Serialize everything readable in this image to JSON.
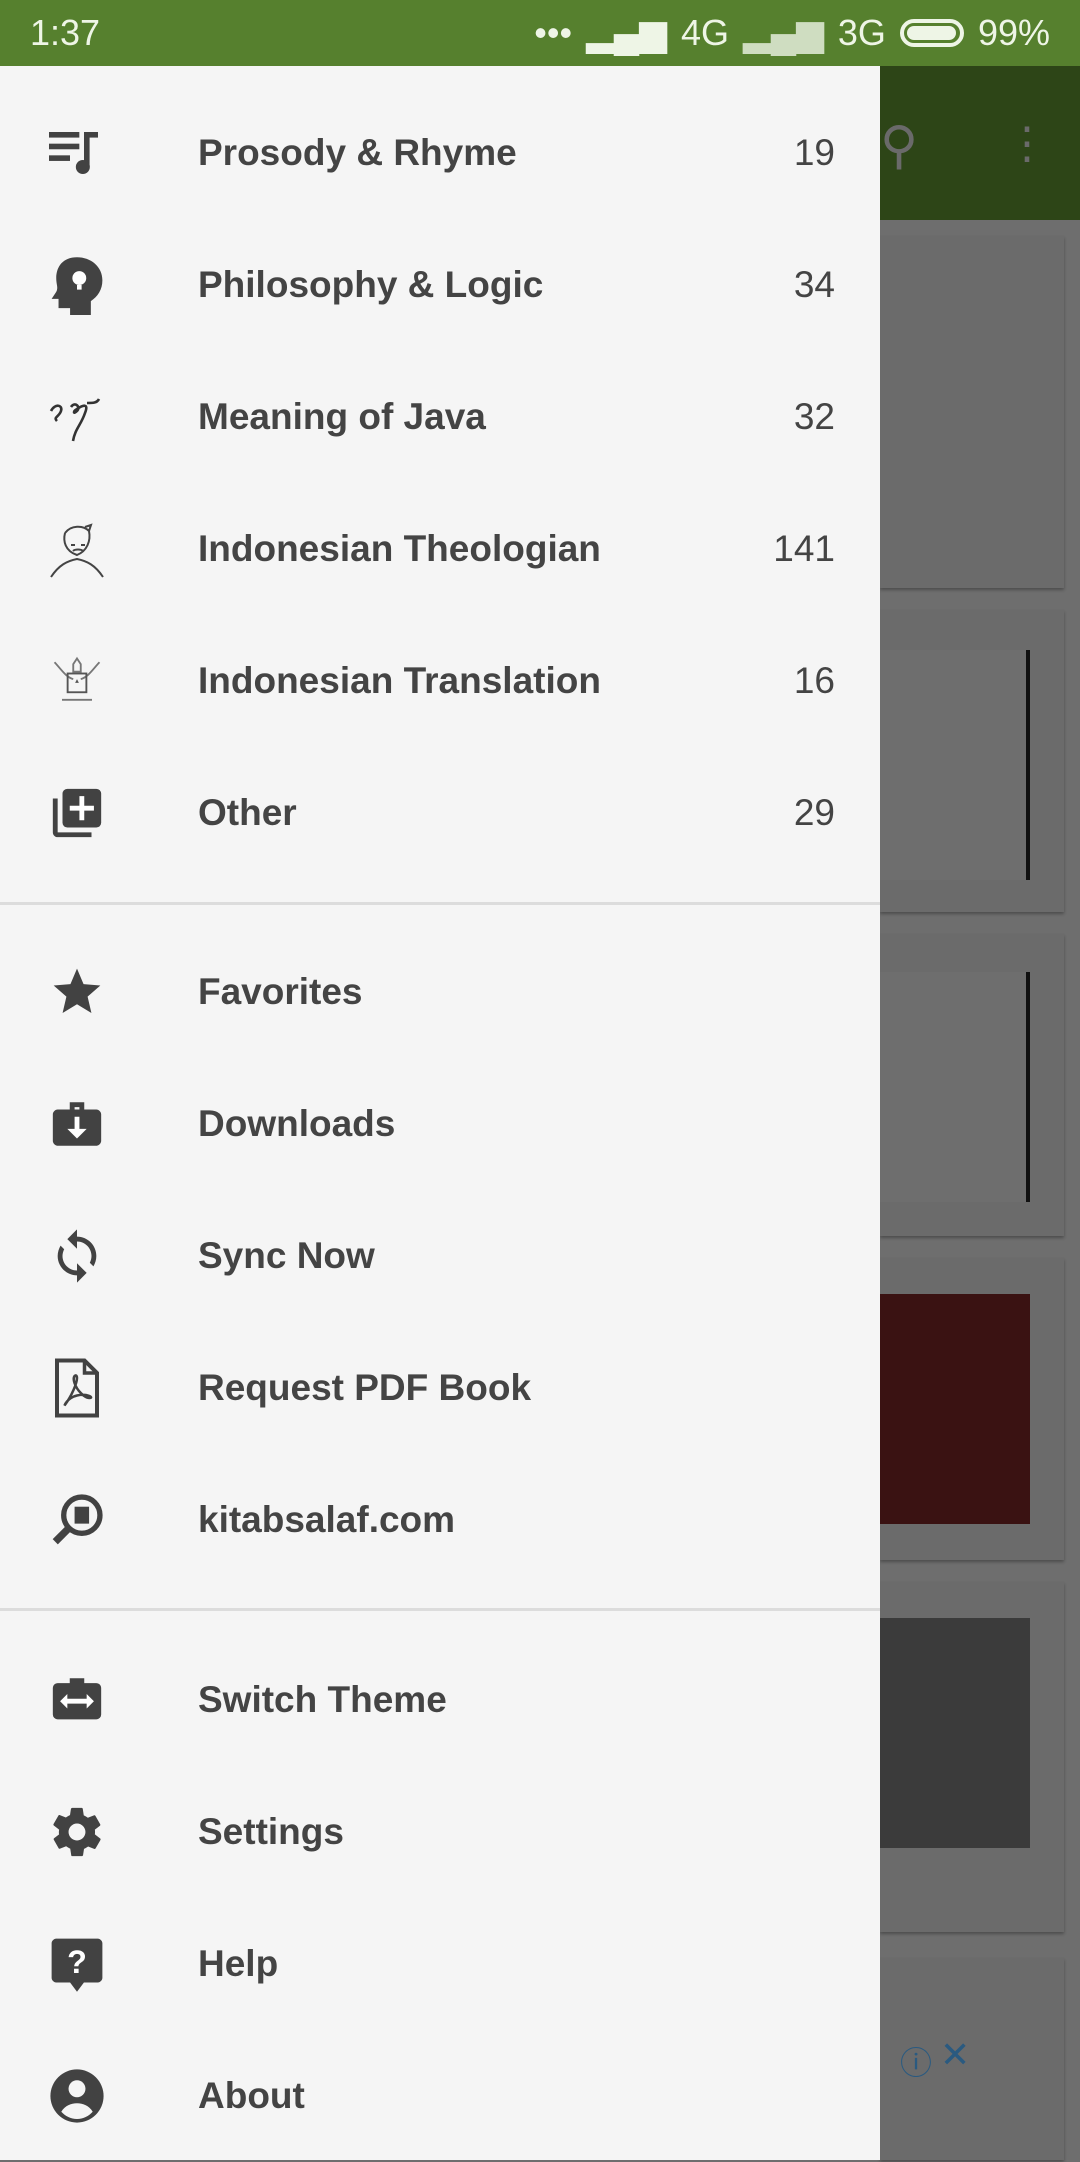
{
  "status_bar": {
    "time": "1:37",
    "network1": "4G",
    "network2": "3G",
    "battery": "99%",
    "battery_level": 0.99
  },
  "categories": [
    {
      "label": "Prosody & Rhyme",
      "count": "19",
      "icon": "music-list-icon"
    },
    {
      "label": "Philosophy & Logic",
      "count": "34",
      "icon": "head-lightbulb-icon"
    },
    {
      "label": "Meaning of Java",
      "count": "32",
      "icon": "javanese-script-icon"
    },
    {
      "label": "Indonesian Theologian",
      "count": "141",
      "icon": "theologian-portrait-icon"
    },
    {
      "label": "Indonesian Translation",
      "count": "16",
      "icon": "garuda-emblem-icon"
    },
    {
      "label": "Other",
      "count": "29",
      "icon": "library-add-icon"
    }
  ],
  "actions": [
    {
      "label": "Favorites",
      "icon": "star-icon"
    },
    {
      "label": "Downloads",
      "icon": "download-briefcase-icon"
    },
    {
      "label": "Sync Now",
      "icon": "sync-icon"
    },
    {
      "label": "Request PDF Book",
      "icon": "pdf-file-icon"
    },
    {
      "label": "kitabsalaf.com",
      "icon": "web-search-book-icon"
    }
  ],
  "settings": [
    {
      "label": "Switch Theme",
      "icon": "switch-theme-icon"
    },
    {
      "label": "Settings",
      "icon": "gear-icon"
    },
    {
      "label": "Help",
      "icon": "help-icon"
    },
    {
      "label": "About",
      "icon": "account-circle-icon"
    }
  ]
}
